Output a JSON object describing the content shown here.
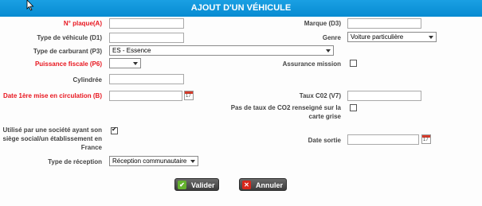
{
  "dialog": {
    "title": "AJOUT D'UN VÉHICULE"
  },
  "fields": {
    "plaque": {
      "label": "N° plaque(A)",
      "value": ""
    },
    "marque": {
      "label": "Marque (D3)",
      "value": ""
    },
    "type_vehicule": {
      "label": "Type de véhicule (D1)",
      "value": ""
    },
    "genre": {
      "label": "Genre",
      "value": "Voiture particulière"
    },
    "carburant": {
      "label": "Type de carburant (P3)",
      "value": "ES - Essence"
    },
    "puissance": {
      "label": "Puissance fiscale (P6)",
      "value": ""
    },
    "assurance": {
      "label": "Assurance mission",
      "checked": false
    },
    "cylindree": {
      "label": "Cylindrée",
      "value": ""
    },
    "date_circulation": {
      "label": "Date 1ère mise en circulation (B)",
      "value": ""
    },
    "taux_co2": {
      "label": "Taux C02 (V7)",
      "value": ""
    },
    "pas_co2": {
      "label": "Pas de taux de CO2 renseigné sur la carte grise",
      "checked": false
    },
    "societe": {
      "label": "Utilisé par une société ayant son siège social/un établissement en France",
      "checked": true
    },
    "date_sortie": {
      "label": "Date sortie",
      "value": ""
    },
    "reception": {
      "label": "Type de réception",
      "value": "Réception communautaire"
    }
  },
  "buttons": {
    "valider": "Valider",
    "annuler": "Annuler"
  },
  "colors": {
    "titlebar": "#0a8fd4",
    "required": "#e8161f"
  }
}
